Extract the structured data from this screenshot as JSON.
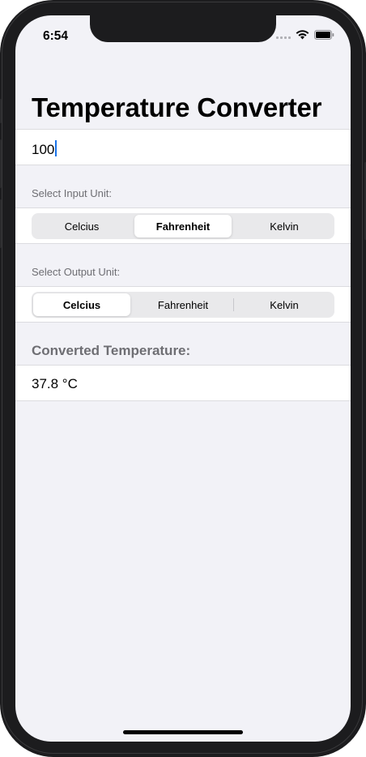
{
  "status_bar": {
    "time": "6:54"
  },
  "app": {
    "title": "Temperature Converter",
    "input": {
      "value": "100"
    },
    "input_unit": {
      "label": "Select Input Unit:",
      "options": [
        "Celcius",
        "Fahrenheit",
        "Kelvin"
      ],
      "selected": "Fahrenheit"
    },
    "output_unit": {
      "label": "Select Output Unit:",
      "options": [
        "Celcius",
        "Fahrenheit",
        "Kelvin"
      ],
      "selected": "Celcius"
    },
    "result": {
      "label": "Converted Temperature:",
      "value": "37.8 °C"
    }
  },
  "icons": {
    "signal": "cellular-signal-icon",
    "wifi": "wifi-icon",
    "battery": "battery-icon"
  }
}
